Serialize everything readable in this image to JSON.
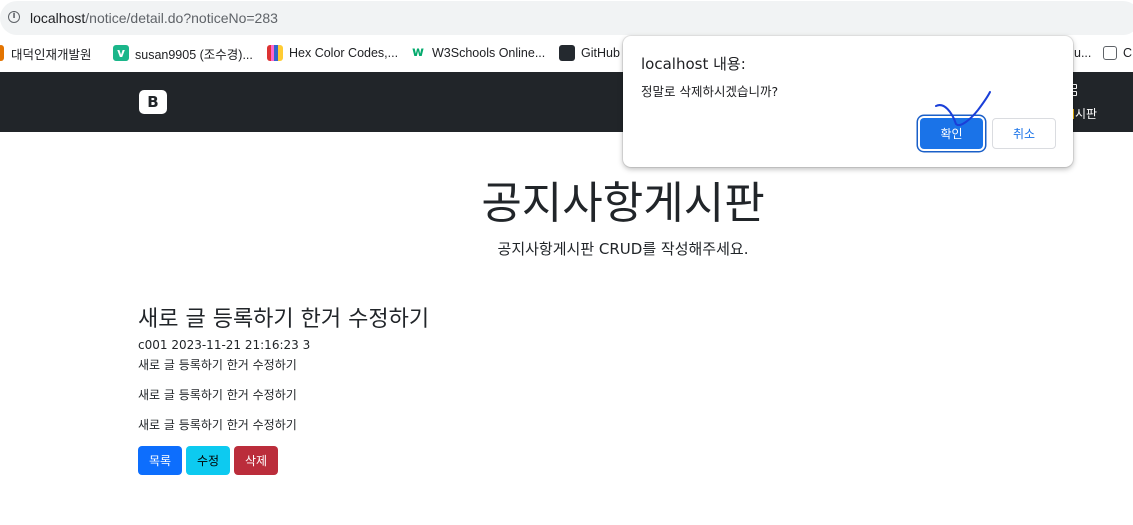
{
  "browser": {
    "url_host": "localhost",
    "url_path": "/notice/detail.do?noticeNo=283",
    "bookmarks": [
      {
        "label": "대덕인재개발원",
        "icon": "leaf-icon"
      },
      {
        "label": "susan9905 (조수경)...",
        "icon": "vue-icon"
      },
      {
        "label": "Hex Color Codes,...",
        "icon": "book-icon"
      },
      {
        "label": "W3Schools Online...",
        "icon": "w3schools-icon"
      },
      {
        "label": "GitHub",
        "icon": "github-icon"
      },
      {
        "label": "u...",
        "icon": ""
      },
      {
        "label": "C",
        "icon": "globe-icon"
      }
    ]
  },
  "navbar": {
    "brand": "B",
    "link_label": "시판"
  },
  "hero": {
    "title": "공지사항게시판",
    "subtitle": "공지사항게시판 CRUD를 작성해주세요."
  },
  "post": {
    "title": "새로 글 등록하기 한거 수정하기",
    "meta": "c001 2023-11-21 21:16:23 3",
    "lines": [
      "새로 글 등록하기 한거 수정하기",
      "새로 글 등록하기 한거 수정하기",
      "새로 글 등록하기 한거 수정하기"
    ],
    "buttons": {
      "list": "목록",
      "edit": "수정",
      "delete": "삭제"
    }
  },
  "dialog": {
    "title": "localhost 내용:",
    "message": "정말로 삭제하시겠습니까?",
    "ok_label": "확인",
    "cancel_label": "취소"
  },
  "colors": {
    "navbar_bg": "#212529",
    "primary": "#0d6efd",
    "info": "#0dcaf0",
    "danger": "#bb2d3b",
    "dialog_accent": "#1a73e8"
  }
}
